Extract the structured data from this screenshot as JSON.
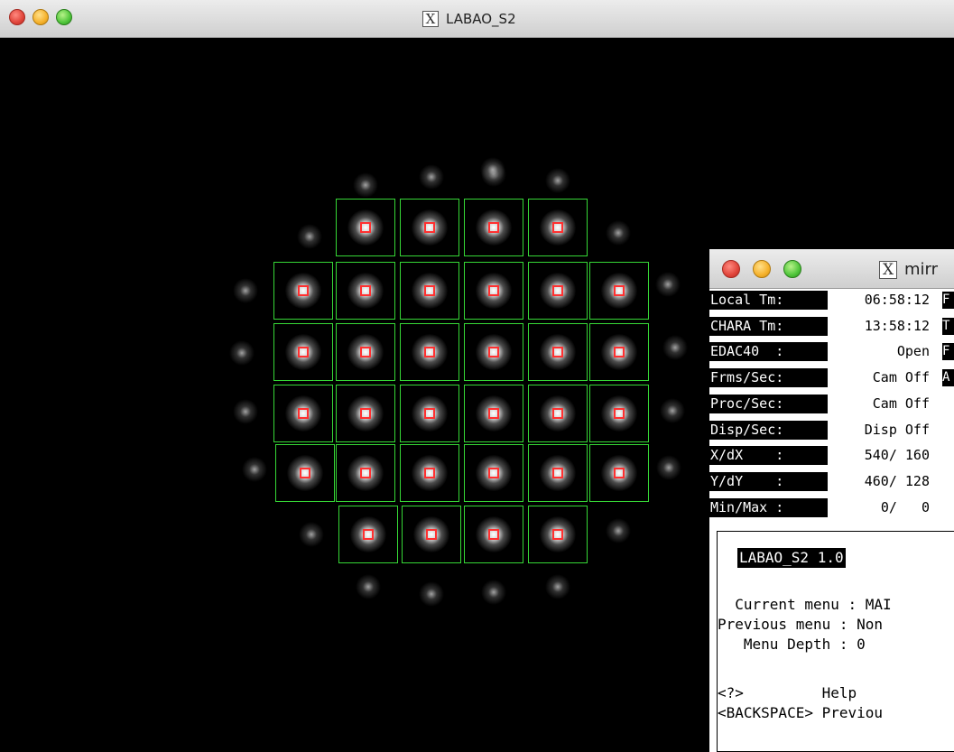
{
  "main_window": {
    "title": "LABAO_S2",
    "title_icon": "x11-icon"
  },
  "mirror_window": {
    "title": "mirr",
    "title_icon": "x11-icon",
    "status_rows": [
      {
        "label": "Local Tm:",
        "value": "06:58:12",
        "flag": "F"
      },
      {
        "label": "CHARA Tm:",
        "value": "13:58:12",
        "flag": "T"
      },
      {
        "label": "EDAC40  :",
        "value": "Open",
        "flag": "F"
      },
      {
        "label": "Frms/Sec:",
        "value": "Cam Off",
        "flag": "A"
      },
      {
        "label": "Proc/Sec:",
        "value": "Cam Off",
        "flag": ""
      },
      {
        "label": "Disp/Sec:",
        "value": "Disp Off",
        "flag": ""
      },
      {
        "label": "X/dX    :",
        "value": "540/ 160",
        "flag": ""
      },
      {
        "label": "Y/dY    :",
        "value": "460/ 128",
        "flag": ""
      },
      {
        "label": "Min/Max :",
        "value": "0/   0",
        "flag": ""
      }
    ],
    "menu_panel": {
      "title": "LABAO_S2 1.0",
      "current_menu": "  Current menu : MAI",
      "previous_menu": "Previous menu : Non",
      "menu_depth": "   Menu Depth : 0",
      "key_help": "<?>         Help",
      "key_backspace": "<BACKSPACE> Previou"
    }
  },
  "colors": {
    "box_outline": "#36d836",
    "centroid_marker": "#ff3030",
    "canvas_bg": "#000000"
  }
}
